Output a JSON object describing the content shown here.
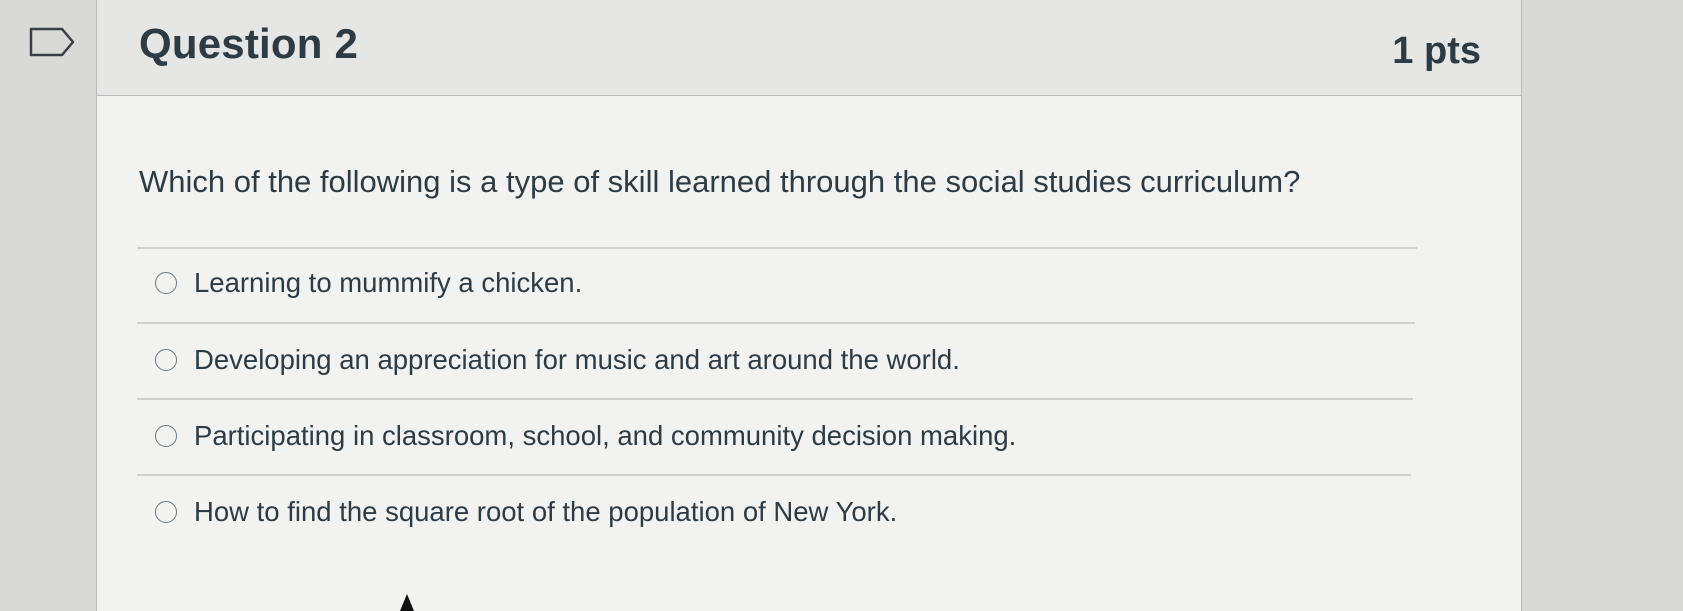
{
  "question": {
    "title": "Question 2",
    "points": "1 pts",
    "text": "Which of the following is a type of skill learned through the social studies curriculum?",
    "flag_icon": "bookmark-flag-icon"
  },
  "answers": [
    {
      "label": "Learning to mummify a chicken.",
      "selected": false
    },
    {
      "label": "Developing an appreciation for music and art around the world.",
      "selected": false
    },
    {
      "label": "Participating in classroom, school, and community decision making.",
      "selected": false
    },
    {
      "label": "How to find the square root of the population of New York.",
      "selected": false
    }
  ],
  "colors": {
    "text": "#2d3b45",
    "card_background": "#f2f2f0",
    "header_background": "#e6e6e4",
    "border": "#b9bcbd"
  }
}
